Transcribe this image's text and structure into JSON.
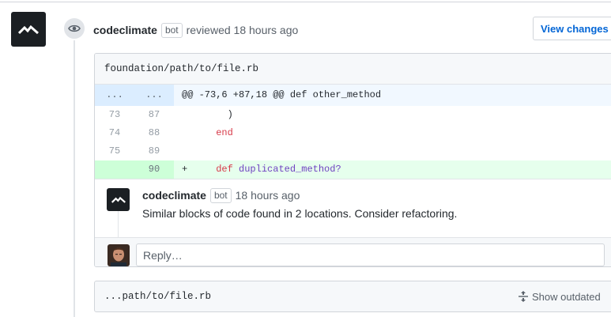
{
  "review": {
    "author": "codeclimate",
    "badge": "bot",
    "action_text": "reviewed 18 hours ago",
    "view_changes_label": "View changes"
  },
  "file": {
    "path": "foundation/path/to/file.rb",
    "hunk": {
      "left_marker": "...",
      "right_marker": "...",
      "header": "@@ -73,6 +87,18 @@ def other_method"
    },
    "lines": [
      {
        "old": "73",
        "new": "87",
        "sign": "",
        "text": "        )"
      },
      {
        "old": "74",
        "new": "88",
        "sign": "",
        "kw": "end"
      },
      {
        "old": "75",
        "new": "89",
        "sign": "",
        "text": ""
      },
      {
        "old": "",
        "new": "90",
        "sign": "+",
        "kw": "def",
        "fn": "duplicated_method?"
      }
    ]
  },
  "comment": {
    "author": "codeclimate",
    "badge": "bot",
    "time": "18 hours ago",
    "body": "Similar blocks of code found in 2 locations. Consider refactoring."
  },
  "reply": {
    "placeholder": "Reply…"
  },
  "file2": {
    "path": "...path/to/file.rb",
    "show_outdated_label": "Show outdated"
  },
  "icons": {
    "review_avatar": "codeclimate-logo-icon",
    "timeline": "eye-icon",
    "outdated": "unfold-icon"
  },
  "colors": {
    "link": "#0366d6",
    "addition_bg": "#e6ffed",
    "hunk_bg": "#f1f8ff",
    "keyword": "#d73a49",
    "function": "#6f42c1"
  }
}
